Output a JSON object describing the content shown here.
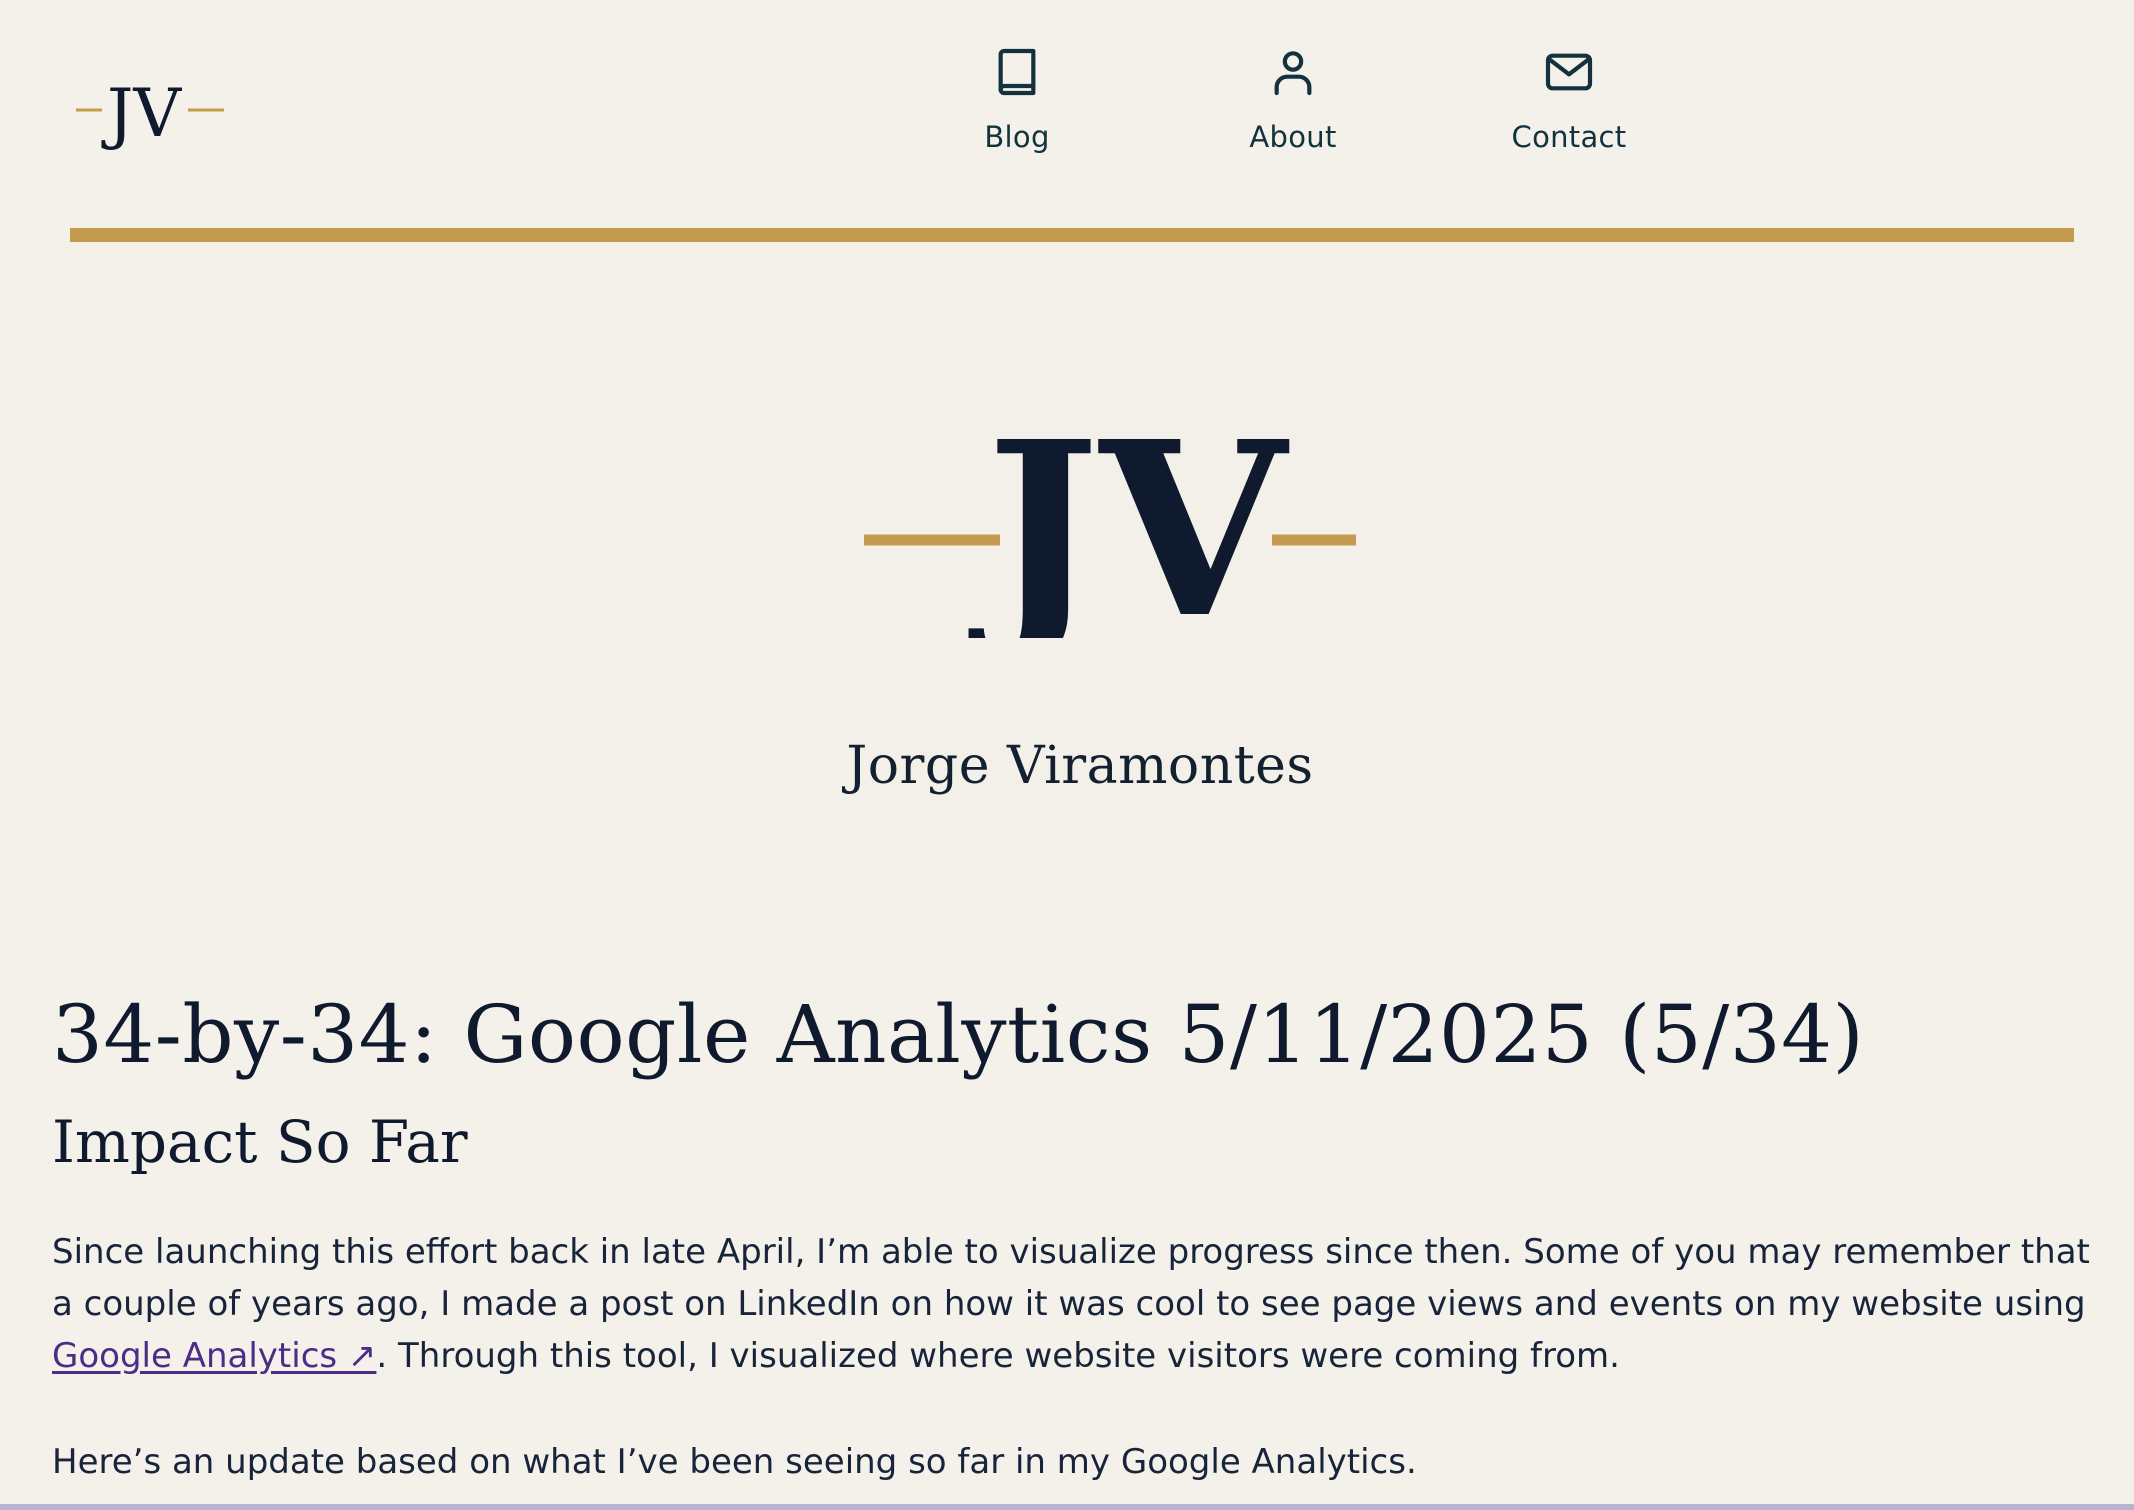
{
  "header": {
    "logo_text": "JV",
    "nav": [
      {
        "label": "Blog",
        "icon": "book-icon"
      },
      {
        "label": "About",
        "icon": "user-icon"
      },
      {
        "label": "Contact",
        "icon": "mail-icon"
      }
    ]
  },
  "hero": {
    "logo_text": "JV",
    "name": "Jorge Viramontes"
  },
  "article": {
    "title": "34-by-34: Google Analytics 5/11/2025 (5/34)",
    "section_heading": "Impact So Far",
    "paragraph1_before_link": "Since launching this effort back in late April, I’m able to visualize progress since then. Some of you may remember that a couple of years ago, I made a post on LinkedIn on how it was cool to see page views and events on my website using ",
    "link_text": "Google Analytics ↗",
    "paragraph1_after_link": ". Through this tool, I visualized where website visitors were coming from.",
    "paragraph2": "Here’s an update based on what I’ve been seeing so far in my Google Analytics."
  },
  "colors": {
    "accent_gold": "#c49a4c",
    "navy": "#0f1a2e",
    "background": "#f4f1eb",
    "link": "#4b2c87"
  }
}
